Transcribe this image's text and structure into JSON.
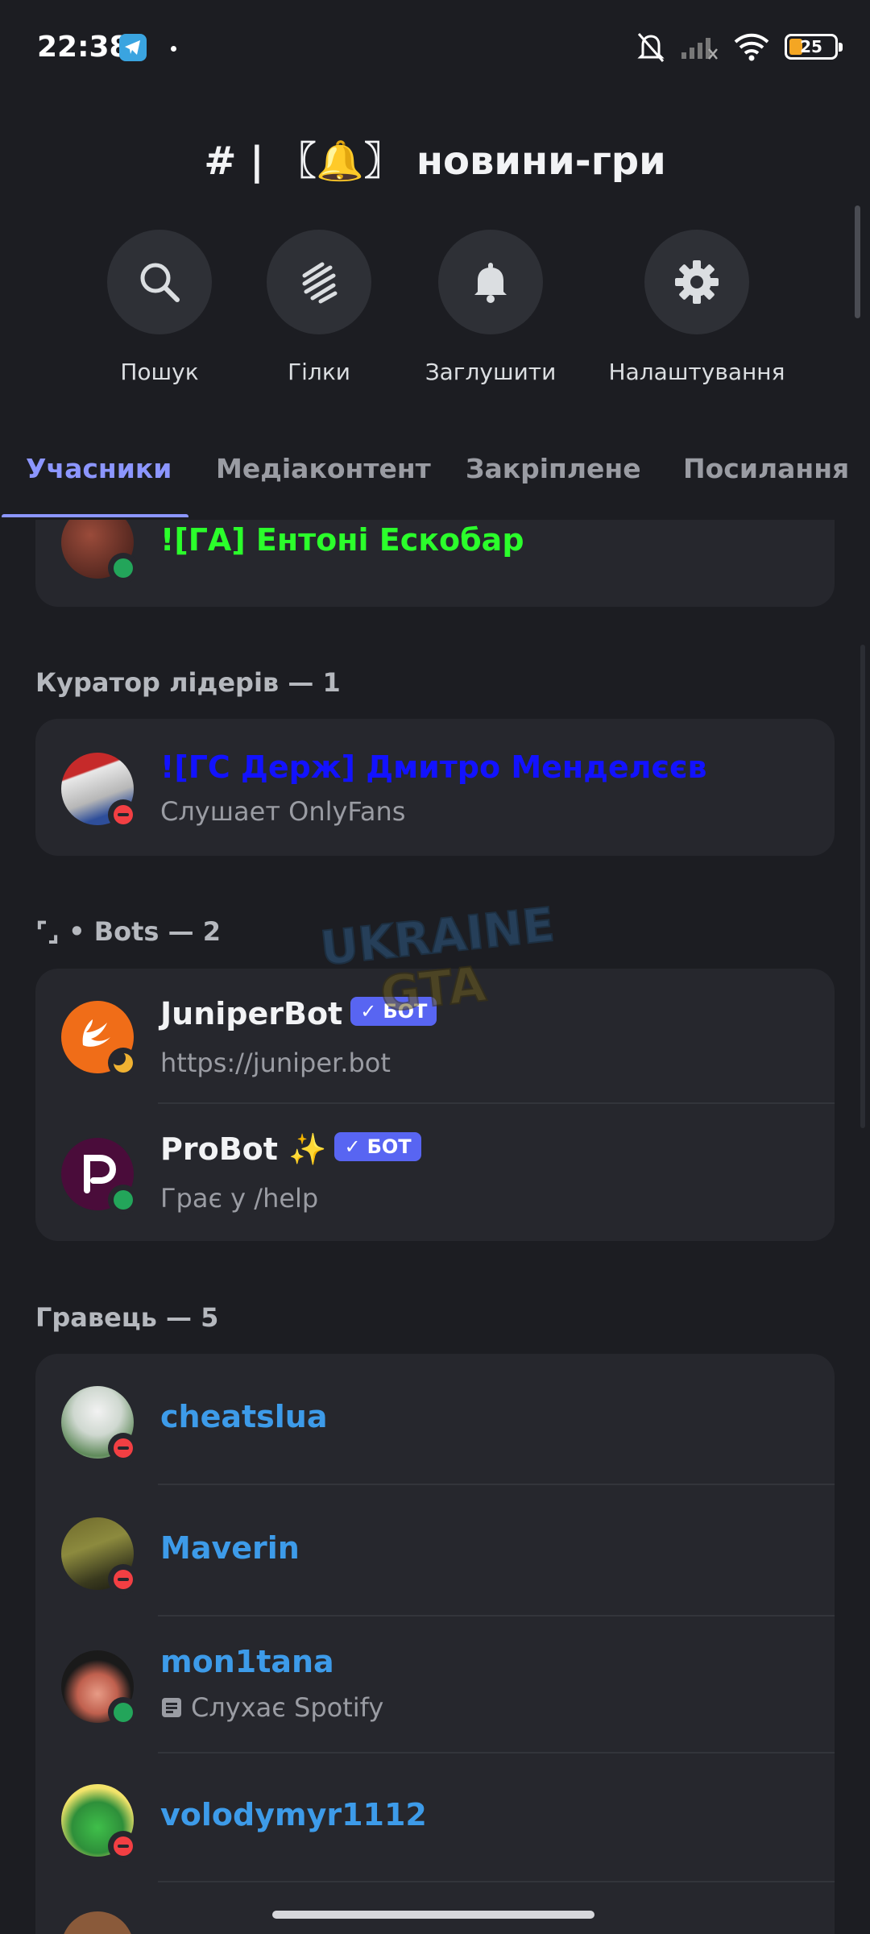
{
  "status_bar": {
    "time": "22:38",
    "battery": "25"
  },
  "channel": {
    "title": "#  |  〖🔔〗 новини-гри"
  },
  "actions": [
    {
      "label": "Пошук",
      "icon": "search-icon"
    },
    {
      "label": "Гілки",
      "icon": "threads-icon"
    },
    {
      "label": "Заглушити",
      "icon": "bell-icon"
    },
    {
      "label": "Налаштування",
      "icon": "gear-icon"
    }
  ],
  "tabs": [
    "Учасники",
    "Медіаконтент",
    "Закріплене",
    "Посилання"
  ],
  "top_member": {
    "name": "![ГА] Ентоні Ескобар",
    "color": "#2bff2b"
  },
  "sections": {
    "curator": "Куратор лідерів — 1",
    "bots": "⌜⌟ • Bots — 2",
    "players": "Гравець — 5"
  },
  "curator_member": {
    "name": "![ГС Держ] Дмитро Менделєєв",
    "activity": "Слушает OnlyFans",
    "color": "#1212ff"
  },
  "bots": [
    {
      "name": "JuniperBot",
      "badge": "БОТ",
      "activity": "https://juniper.bot"
    },
    {
      "name": "ProBot ✨",
      "badge": "БОТ",
      "activity": "Грає у /help"
    }
  ],
  "players": [
    {
      "name": "cheatslua",
      "activity": ""
    },
    {
      "name": "Maverin",
      "activity": ""
    },
    {
      "name": "mon1tana",
      "activity": "Слухає Spotify"
    },
    {
      "name": "volodymyr1112",
      "activity": ""
    }
  ],
  "colors": {
    "player_name": "#3d9be9",
    "accent": "#8c96ff",
    "bot_badge": "#5865f2"
  },
  "watermark": {
    "line1": "UKRAINE",
    "line2": "GTA"
  }
}
